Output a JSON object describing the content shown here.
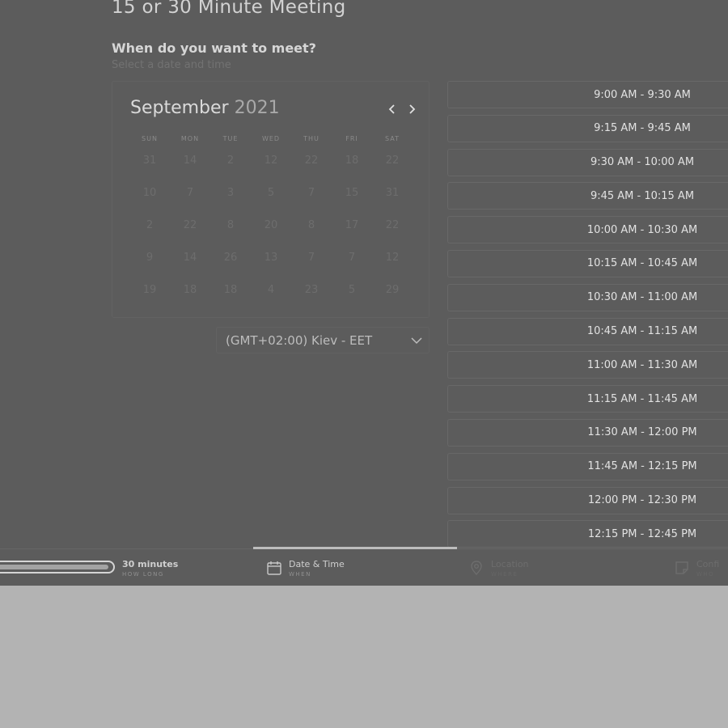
{
  "page": {
    "title": "15 or 30 Minute Meeting",
    "question": "When do you want to meet?",
    "hint": "Select a date and time"
  },
  "calendar": {
    "month": "September",
    "year": "2021",
    "prev_icon": "chevron-left-icon",
    "next_icon": "chevron-right-icon",
    "weekdays": [
      "SUN",
      "MON",
      "TUE",
      "WED",
      "THU",
      "FRI",
      "SAT"
    ],
    "weeks": [
      [
        "31",
        "14",
        "2",
        "12",
        "22",
        "18",
        "22"
      ],
      [
        "10",
        "7",
        "3",
        "5",
        "7",
        "15",
        "31"
      ],
      [
        "2",
        "22",
        "8",
        "20",
        "8",
        "17",
        "22"
      ],
      [
        "9",
        "14",
        "26",
        "13",
        "7",
        "7",
        "12"
      ],
      [
        "19",
        "18",
        "18",
        "4",
        "23",
        "5",
        "29"
      ]
    ]
  },
  "timezone": {
    "label": "(GMT+02:00) Kiev - EET",
    "icon": "chevron-down-icon"
  },
  "time_slots": [
    "9:00 AM - 9:30 AM",
    "9:15 AM - 9:45 AM",
    "9:30 AM - 10:00 AM",
    "9:45 AM - 10:15 AM",
    "10:00 AM - 10:30 AM",
    "10:15 AM - 10:45 AM",
    "10:30 AM - 11:00 AM",
    "10:45 AM - 11:15 AM",
    "11:00 AM - 11:30 AM",
    "11:15 AM - 11:45 AM",
    "11:30 AM - 12:00 PM",
    "11:45 AM - 12:15 PM",
    "12:00 PM - 12:30 PM",
    "12:15 PM - 12:45 PM"
  ],
  "steps": {
    "duration": {
      "label": "30 minutes",
      "sub": "HOW LONG",
      "progress_percent": 96
    },
    "datetime": {
      "label": "Date & Time",
      "sub": "WHEN",
      "icon": "calendar-icon"
    },
    "location": {
      "label": "Location",
      "sub": "WHERE",
      "icon": "map-pin-icon"
    },
    "confirm": {
      "label": "Confi",
      "sub": "WHO",
      "icon": "note-icon"
    }
  },
  "colors": {
    "overlay_background": "#5c5c5c",
    "page_background": "#b3b3b3"
  }
}
